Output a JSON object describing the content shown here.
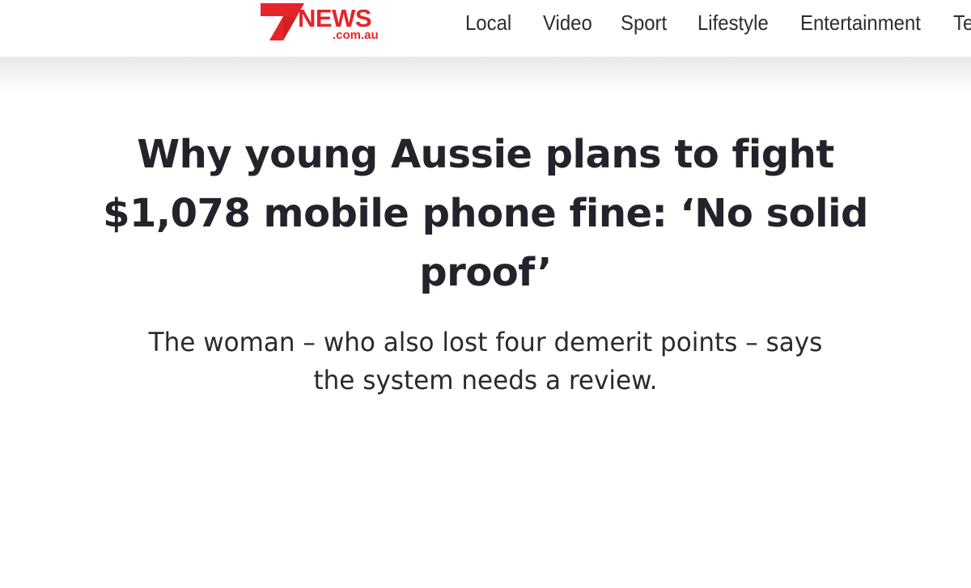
{
  "brand": {
    "logo_numeral": "7",
    "logo_word": "NEWS",
    "logo_domain": ".com.au",
    "color": "#e4252a"
  },
  "nav": {
    "items": [
      "Local",
      "Video",
      "Sport",
      "Lifestyle",
      "Entertainment",
      "Te"
    ]
  },
  "article": {
    "headline": "Why young Aussie plans to fight $1,078 mobile phone fine: ‘No solid proof’",
    "standfirst": "The woman – who also lost four demerit points – says the system needs a review."
  }
}
